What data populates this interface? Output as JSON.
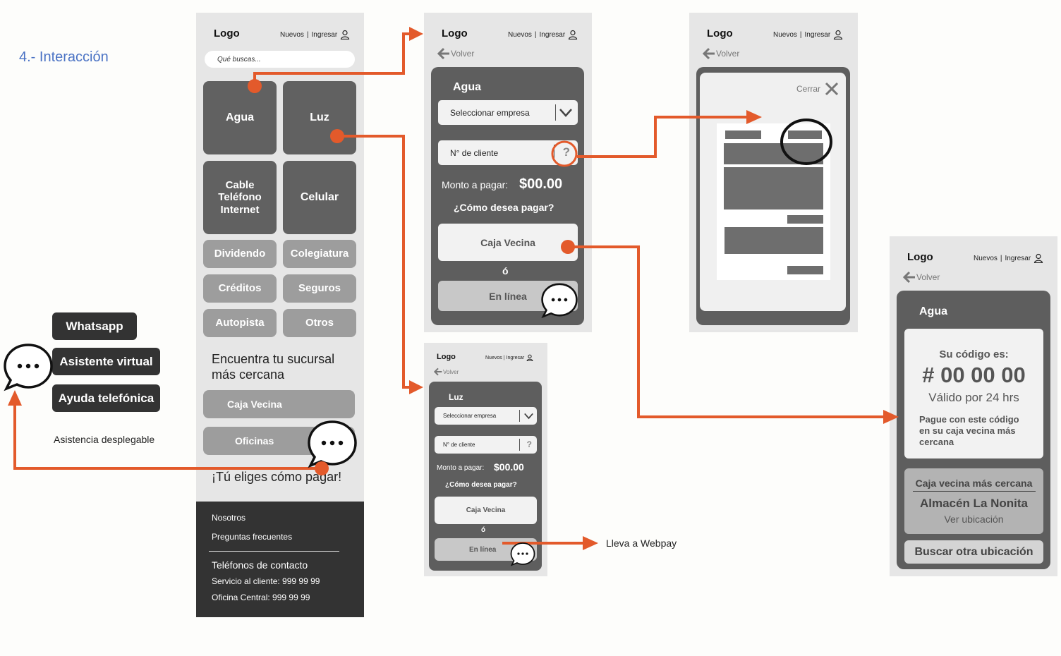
{
  "section_title": "4.- Interacción",
  "header": {
    "logo": "Logo",
    "nuevos": "Nuevos",
    "ingresar": "Ingresar",
    "back": "Volver"
  },
  "home": {
    "search_placeholder": "Qué buscas...",
    "tiles": [
      "Agua",
      "Luz",
      "Cable\nTeléfono\nInternet",
      "Celular"
    ],
    "small_tiles": [
      "Dividendo",
      "Colegiatura",
      "Créditos",
      "Seguros",
      "Autopista",
      "Otros"
    ],
    "branch_title": "Encuentra tu sucursal\nmás cercana",
    "branch_buttons": [
      "Caja Vecina",
      "Oficinas"
    ],
    "slogan": "¡Tú eliges cómo pagar!",
    "footer": {
      "links": [
        "Nosotros",
        "Preguntas frecuentes"
      ],
      "contact_title": "Teléfonos de contacto",
      "service": "Servicio al cliente:  999 99 99",
      "office": "Oficina Central: 999 99 99"
    }
  },
  "help_menu": {
    "options": [
      "Whatsapp",
      "Asistente virtual",
      "Ayuda telefónica"
    ],
    "caption": "Asistencia desplegable"
  },
  "payment_agua": {
    "title": "Agua",
    "select_company": "Seleccionar empresa",
    "client_number": "N° de cliente",
    "amount_label": "Monto a pagar:",
    "amount_value": "$00.00",
    "question": "¿Cómo desea pagar?",
    "option_caja": "Caja Vecina",
    "or": "ó",
    "option_online": "En línea",
    "help_mark": "?"
  },
  "payment_luz": {
    "title": "Luz",
    "select_company": "Seleccionar empresa",
    "client_number": "N° de cliente",
    "amount_label": "Monto a pagar:",
    "amount_value": "$00.00",
    "question": "¿Cómo desea pagar?",
    "option_caja": "Caja Vecina",
    "or": "ó",
    "option_online": "En línea",
    "help_mark": "?"
  },
  "webpay_note": "Lleva a Webpay",
  "modal": {
    "close_label": "Cerrar"
  },
  "code_screen": {
    "title": "Agua",
    "code_label": "Su código es:",
    "code": "# 00 00 00",
    "validity": "Válido por 24 hrs",
    "instructions": "Pague con este código\nen su caja vecina más\ncercana",
    "nearest_label": "Caja vecina más cercana",
    "store_name": "Almacén La Nonita",
    "view_location": "Ver ubicación",
    "other_location": "Buscar otra ubicación"
  },
  "colors": {
    "accent": "#e35a2b",
    "screen_bg": "#e6e6e6",
    "panel": "#5e5e5e",
    "tile_dark": "#616161",
    "tile_light": "#9d9d9d",
    "footer": "#333333",
    "title_blue": "#4a72c4"
  }
}
